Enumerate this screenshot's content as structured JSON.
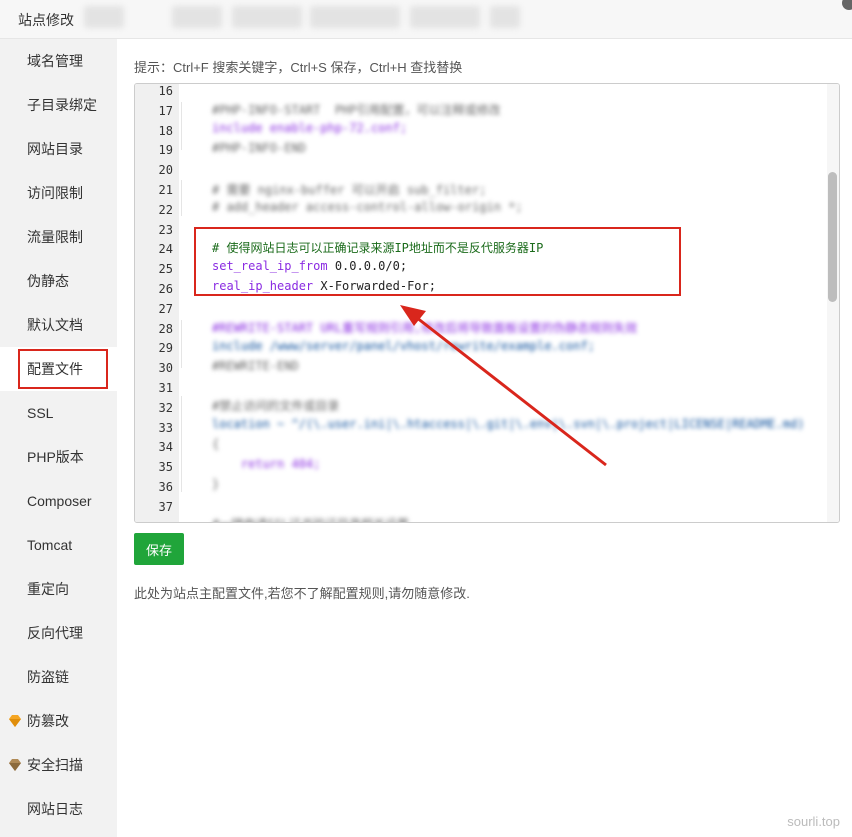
{
  "window": {
    "title": "站点修改"
  },
  "sidebar": {
    "items": [
      {
        "label": "域名管理"
      },
      {
        "label": "子目录绑定"
      },
      {
        "label": "网站目录"
      },
      {
        "label": "访问限制"
      },
      {
        "label": "流量限制"
      },
      {
        "label": "伪静态"
      },
      {
        "label": "默认文档"
      },
      {
        "label": "配置文件",
        "active": true
      },
      {
        "label": "SSL"
      },
      {
        "label": "PHP版本"
      },
      {
        "label": "Composer"
      },
      {
        "label": "Tomcat"
      },
      {
        "label": "重定向"
      },
      {
        "label": "反向代理"
      },
      {
        "label": "防盗链"
      },
      {
        "label": "防篡改",
        "icon": "gem-icon"
      },
      {
        "label": "安全扫描",
        "icon": "gem-icon"
      },
      {
        "label": "网站日志"
      }
    ]
  },
  "main": {
    "hint": "提示：Ctrl+F 搜索关键字，Ctrl+S 保存，Ctrl+H 查找替换",
    "editor": {
      "line_numbers": [
        "16",
        "17",
        "18",
        "19",
        "20",
        "21",
        "22",
        "23",
        "24",
        "25",
        "26",
        "27",
        "28",
        "29",
        "30",
        "31",
        "32",
        "33",
        "34",
        "35",
        "36",
        "37"
      ],
      "visible_lines": {
        "l24": "# 使得网站日志可以正确记录来源IP地址而不是反代服务器IP",
        "l25_kw": "set_real_ip_from",
        "l25_val": " 0.0.0.0/0;",
        "l26_kw": "real_ip_header",
        "l26_val": " X-Forwarded-For;"
      },
      "blurred_lines": {
        "l17": "#PHP-INFO-START  PHP引用配置，可以注释或修改",
        "l18": "include enable-php-72.conf;",
        "l19": "#PHP-INFO-END",
        "l21": "# 需要 nginx-buffer 可以开启 sub_filter;",
        "l22": "# add_header access-control-allow-origin *;",
        "l28": "#REWRITE-START URL重写规则引用,修改后将导致面板设置的伪静态规则失效",
        "l29": "include /www/server/panel/vhost/rewrite/example.conf;",
        "l30": "#REWRITE-END",
        "l32": "#禁止访问的文件或目录",
        "l33": "location ~ ^/(\\.user.ini|\\.htaccess|\\.git|\\.env|\\.svn|\\.project|LICENSE|README.md)",
        "l34": "{",
        "l35": "    return 404;",
        "l36": "}",
        "l38": "#一键申请SSL证书验证目录相关设置"
      }
    },
    "save_label": "保存",
    "note": "此处为站点主配置文件,若您不了解配置规则,请勿随意修改."
  },
  "watermark": "sourli.top",
  "colors": {
    "accent_green": "#20a53a",
    "annotation_red": "#d9261c",
    "comment_green": "#1b6b1b",
    "keyword_purple": "#8a2be2"
  }
}
